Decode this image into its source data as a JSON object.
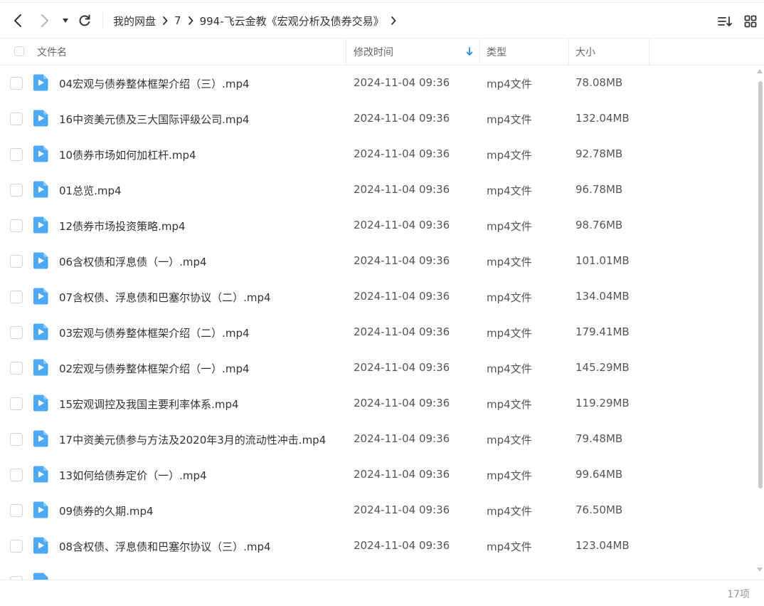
{
  "toolbar": {
    "breadcrumb": [
      "我的网盘",
      "7",
      "994-飞云金教《宏观分析及债券交易》"
    ],
    "icons": [
      "back-icon",
      "forward-icon",
      "history-dropdown-icon",
      "refresh-icon",
      "sort-list-icon",
      "grid-view-icon"
    ]
  },
  "header": {
    "name": "文件名",
    "modified": "修改时间",
    "type": "类型",
    "size": "大小"
  },
  "files": [
    {
      "name": "04宏观与债券整体框架介绍（三）.mp4",
      "time": "2024-11-04 09:36",
      "type": "mp4文件",
      "size": "78.08MB"
    },
    {
      "name": "16中资美元债及三大国际评级公司.mp4",
      "time": "2024-11-04 09:36",
      "type": "mp4文件",
      "size": "132.04MB"
    },
    {
      "name": "10债券市场如何加杠杆.mp4",
      "time": "2024-11-04 09:36",
      "type": "mp4文件",
      "size": "92.78MB"
    },
    {
      "name": "01总览.mp4",
      "time": "2024-11-04 09:36",
      "type": "mp4文件",
      "size": "96.78MB"
    },
    {
      "name": "12债券市场投资策略.mp4",
      "time": "2024-11-04 09:36",
      "type": "mp4文件",
      "size": "98.76MB"
    },
    {
      "name": "06含权债和浮息债（一）.mp4",
      "time": "2024-11-04 09:36",
      "type": "mp4文件",
      "size": "101.01MB"
    },
    {
      "name": "07含权债、浮息债和巴塞尔协议（二）.mp4",
      "time": "2024-11-04 09:36",
      "type": "mp4文件",
      "size": "134.04MB"
    },
    {
      "name": "03宏观与债券整体框架介绍（二）.mp4",
      "time": "2024-11-04 09:36",
      "type": "mp4文件",
      "size": "179.41MB"
    },
    {
      "name": "02宏观与债券整体框架介绍（一）.mp4",
      "time": "2024-11-04 09:36",
      "type": "mp4文件",
      "size": "145.29MB"
    },
    {
      "name": "15宏观调控及我国主要利率体系.mp4",
      "time": "2024-11-04 09:36",
      "type": "mp4文件",
      "size": "119.29MB"
    },
    {
      "name": "17中资美元债参与方法及2020年3月的流动性冲击.mp4",
      "time": "2024-11-04 09:36",
      "type": "mp4文件",
      "size": "79.48MB"
    },
    {
      "name": "13如何给债券定价（一）.mp4",
      "time": "2024-11-04 09:36",
      "type": "mp4文件",
      "size": "99.64MB"
    },
    {
      "name": "09债券的久期.mp4",
      "time": "2024-11-04 09:36",
      "type": "mp4文件",
      "size": "76.50MB"
    },
    {
      "name": "08含权债、浮息债和巴塞尔协议（三）.mp4",
      "time": "2024-11-04 09:36",
      "type": "mp4文件",
      "size": "123.04MB"
    }
  ],
  "footer": {
    "count": "17项"
  },
  "colors": {
    "accent": "#2b8cf0",
    "file_icon": "#4ea9f5"
  }
}
